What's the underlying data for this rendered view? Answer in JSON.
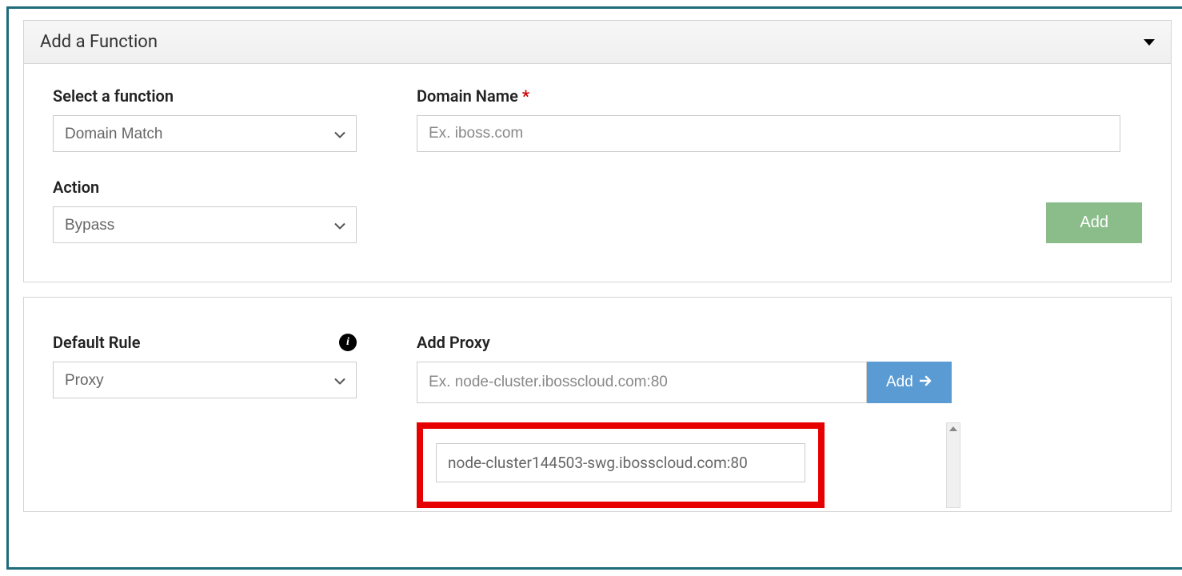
{
  "panel1": {
    "title": "Add a Function",
    "select_function": {
      "label": "Select a function",
      "value": "Domain Match"
    },
    "domain_name": {
      "label": "Domain Name",
      "placeholder": "Ex. iboss.com"
    },
    "action": {
      "label": "Action",
      "value": "Bypass"
    },
    "add_button": "Add"
  },
  "panel2": {
    "default_rule": {
      "label": "Default Rule",
      "value": "Proxy"
    },
    "add_proxy": {
      "label": "Add Proxy",
      "placeholder": "Ex. node-cluster.ibosscloud.com:80",
      "button": "Add"
    },
    "proxy_list": {
      "items": [
        "node-cluster144503-swg.ibosscloud.com:80"
      ]
    }
  }
}
